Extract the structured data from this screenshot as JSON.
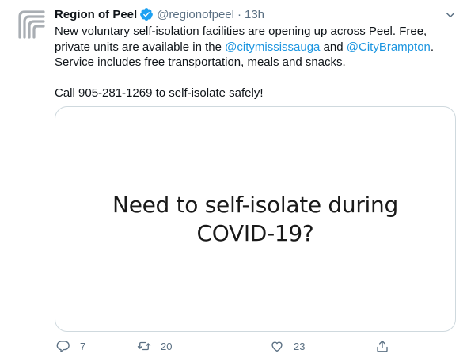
{
  "tweet": {
    "display_name": "Region of Peel",
    "handle": "@regionofpeel",
    "separator": "·",
    "time": "13h",
    "text": {
      "part1": "New voluntary self-isolation facilities are opening up across Peel. Free, private units are available in the ",
      "mention1": "@citymississauga",
      "part2": " and ",
      "mention2": "@CityBrampton",
      "part3": ". Service includes free transportation, meals and snacks.",
      "line2": "Call 905-281-1269 to self-isolate safely!"
    },
    "media": {
      "caption_line1": "Need to self-isolate during",
      "caption_line2": "COVID-19?"
    },
    "actions": {
      "reply_count": "7",
      "retweet_count": "20",
      "like_count": "23"
    }
  },
  "icons": {
    "avatar": "region-of-peel-logo",
    "verified": "verified-badge-icon",
    "more": "chevron-down-icon",
    "reply": "reply-icon",
    "retweet": "retweet-icon",
    "like": "heart-icon",
    "share": "share-icon"
  },
  "colors": {
    "accent": "#1da1f2",
    "mention": "#1b95e0",
    "muted": "#5b7083",
    "text": "#0f1419",
    "border": "#cfd9de"
  }
}
